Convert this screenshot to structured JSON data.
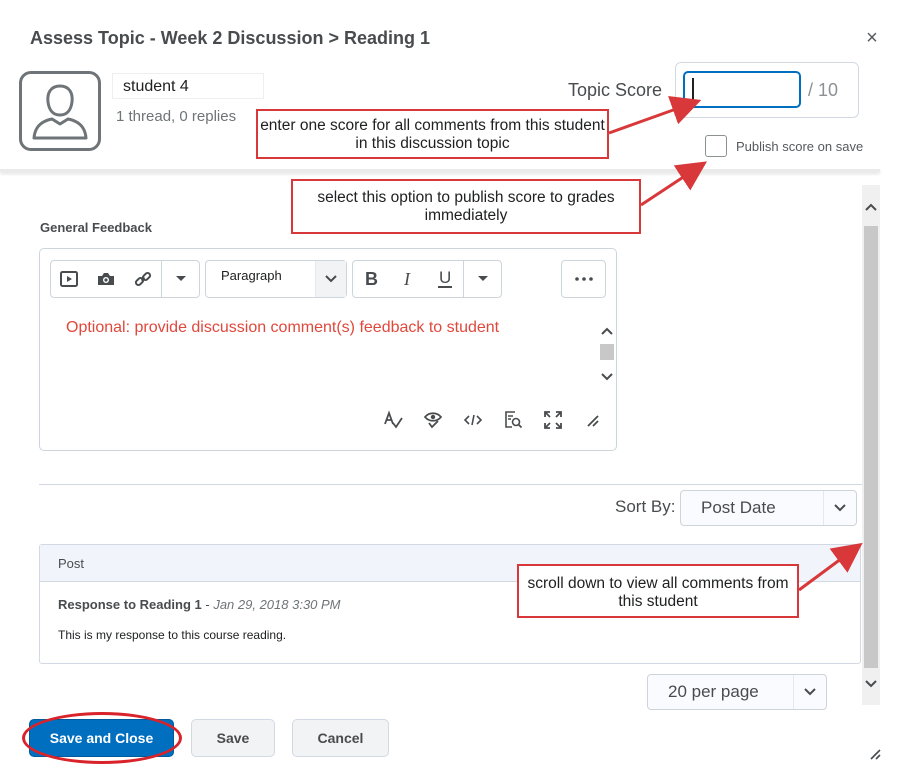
{
  "dialog": {
    "title": "Assess Topic - Week 2 Discussion > Reading 1",
    "close_glyph": "×"
  },
  "student": {
    "name": "student 4",
    "activity": "1 thread, 0 replies",
    "avatar_icon": "user-silhouette-icon"
  },
  "score": {
    "label": "Topic Score",
    "value": "",
    "out_of": "/ 10",
    "publish_label": "Publish score on save",
    "publish_checked": false
  },
  "annotations": {
    "score_note": "enter one score for all comments from this student in this discussion topic",
    "publish_note": "select this option to publish score to grades immediately",
    "scroll_note": "scroll down to view all comments from this student",
    "color": "#d9383a"
  },
  "feedback": {
    "label": "General Feedback",
    "format_selected": "Paragraph",
    "placeholder": "Optional: provide discussion comment(s) feedback to student",
    "toolbar_icons": [
      "insert-video-icon",
      "insert-image-icon",
      "insert-link-icon",
      "more-insert-dropdown-icon",
      "bold-icon",
      "italic-icon",
      "underline-icon",
      "more-format-dropdown-icon",
      "more-options-icon"
    ],
    "footer_icons": [
      "spellcheck-icon",
      "accessibility-checker-icon",
      "source-code-icon",
      "preview-icon",
      "fullscreen-icon",
      "resize-icon"
    ]
  },
  "sort": {
    "label": "Sort By:",
    "selected": "Post Date"
  },
  "posts": {
    "header": "Post",
    "items": [
      {
        "title": "Response to Reading 1",
        "separator": " - ",
        "date": "Jan 29, 2018 3:30 PM",
        "body": "This is my response to this course reading."
      }
    ]
  },
  "paging": {
    "per_page": "20 per page"
  },
  "footer": {
    "save_close": "Save and Close",
    "save": "Save",
    "cancel": "Cancel"
  },
  "colors": {
    "primary": "#006fbf",
    "annotation_red": "#d9383a",
    "placeholder_red": "#e0483c"
  }
}
